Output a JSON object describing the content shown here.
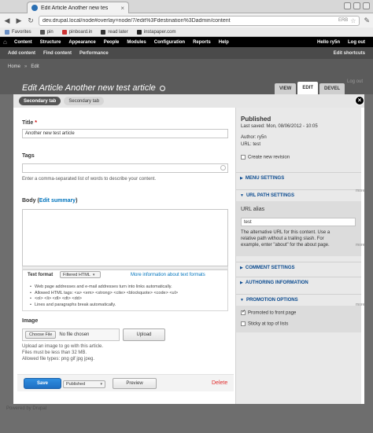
{
  "browser": {
    "tab_title": "Edit Article Another new tes",
    "url": "dev.drupal.local/node#overlay=node/7/edit%3Fdestination%3Dadmin/content",
    "url_ext": "ERB",
    "bookmarks": [
      {
        "label": "Favorites",
        "icon": "folder-icon",
        "color": "#6a8fc4"
      },
      {
        "label": "pin",
        "icon": "tag-icon",
        "color": "#555"
      },
      {
        "label": "pinboard.in",
        "icon": "pinboard-icon",
        "color": "#c33"
      },
      {
        "label": "read later",
        "icon": "readlater-icon",
        "color": "#333"
      },
      {
        "label": "instapaper.com",
        "icon": "instapaper-icon",
        "color": "#222"
      }
    ]
  },
  "toolbar": {
    "menu": [
      "Content",
      "Structure",
      "Appearance",
      "People",
      "Modules",
      "Configuration",
      "Reports",
      "Help"
    ],
    "user": "Hello ry5n",
    "logout": "Log out"
  },
  "shortcuts": {
    "items": [
      "Add content",
      "Find content",
      "Performance"
    ],
    "edit": "Edit shortcuts"
  },
  "overlay": {
    "breadcrumb": [
      "Home",
      "Edit"
    ],
    "title": "Edit Article Another new test article",
    "tabs": [
      "VIEW",
      "EDIT",
      "DEVEL"
    ],
    "close": "×",
    "ghost_logout": "Log out"
  },
  "vertical_tabs": [
    "Secondary tab",
    "Secondary tab"
  ],
  "form": {
    "title_label": "Title",
    "title_value": "Another new test article",
    "tags_label": "Tags",
    "tags_desc": "Enter a comma-separated list of words to describe your content.",
    "body_label": "Body",
    "edit_summary": "Edit summary",
    "text_format_label": "Text format",
    "text_format_value": "Filtered HTML",
    "text_format_link": "More information about text formats",
    "format_tips": [
      "Web page addresses and e-mail addresses turn into links automatically.",
      "Allowed HTML tags: <a> <em> <strong> <cite> <blockquote> <code> <ul>",
      "<ol> <li> <dl> <dt> <dd>",
      "Lines and paragraphs break automatically."
    ],
    "image_label": "Image",
    "choose_file": "Choose File",
    "no_file": "No file chosen",
    "upload": "Upload",
    "image_desc": [
      "Upload an image to go with this article.",
      "Files must be less than 32 MB.",
      "Allowed file types: png gif jpg jpeg."
    ],
    "save": "Save",
    "status_value": "Published",
    "preview": "Preview",
    "delete": "Delete"
  },
  "sidebar": {
    "status": "Published",
    "last_saved": "Last saved: Mon, 08/06/2012 - 10:05",
    "author": "Author: ry5n",
    "url": "URL: test",
    "new_revision": "Create new revision",
    "sections": {
      "menu": "MENU SETTINGS",
      "url_path": "URL PATH SETTINGS",
      "comment": "COMMENT SETTINGS",
      "authoring": "AUTHORING INFORMATION",
      "promotion": "PROMOTION OPTIONS"
    },
    "url_alias_label": "URL alias",
    "url_alias_value": "test",
    "url_alias_desc": [
      "The alternative URL for this content. Use a",
      "relative path without a trailing slash. For",
      "example, enter \"about\" for the about page."
    ],
    "promoted": "Promoted to front page",
    "sticky": "Sticky at top of lists"
  },
  "footer": "Powered by Drupal",
  "ghost_more": "more"
}
